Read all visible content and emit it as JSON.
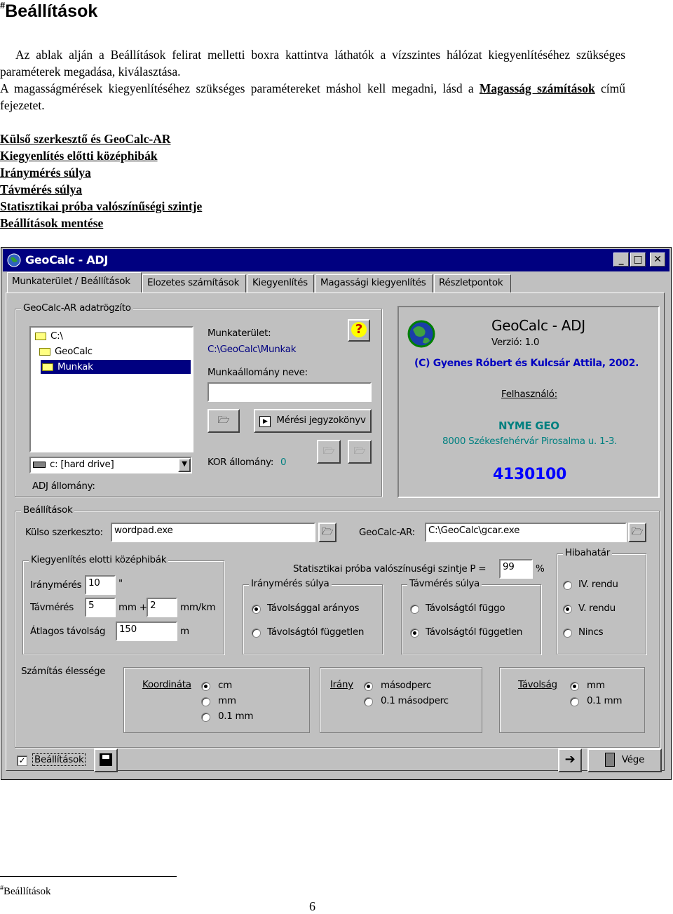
{
  "doc": {
    "title_mark": "#",
    "title": "Beállítások",
    "para1": "Az ablak alján a Beállítások felirat melletti boxra kattintva láthatók a vízszintes hálózat kiegyenlítéséhez szükséges paraméterek megadása, kiválasztása.",
    "para2_prefix": "A magasságmérések kiegyenlítéséhez szükséges paramétereket máshol kell megadni, lásd a ",
    "para2_link": "Magasság számítások",
    "para2_suffix": " című fejezetet.",
    "links": [
      "Külső szerkesztő és GeoCalc-AR",
      "Kiegyenlítés előtti középhibák",
      "Iránymérés súlya",
      "Távmérés súlya",
      "Statisztikai próba valószínűségi szintje",
      "Beállítások mentése"
    ],
    "footnote_mark": "#",
    "footnote": "Beállítások",
    "page_number": "6"
  },
  "window": {
    "title": "GeoCalc - ADJ",
    "controls": [
      "_",
      "□",
      "✕"
    ],
    "tabs": [
      "Munkaterület / Beállítások",
      "Elozetes számítások",
      "Kiegyenlítés",
      "Magassági kiegyenlítés",
      "Részletpontok"
    ],
    "active_tab": 0,
    "adatrogzito": {
      "label": "GeoCalc-AR adatrögzíto",
      "tree": [
        "C:\\",
        "GeoCalc",
        "Munkak"
      ],
      "drive": "c: [hard drive]",
      "munkaterulet_label": "Munkaterület:",
      "munkaterulet_value": "C:\\GeoCalc\\Munkak",
      "munkaallomany_label": "Munkaállomány neve:",
      "munkaallomany_value": "",
      "meresi_button": "Mérési jegyzokönyv",
      "kor_label": "KOR állomány:",
      "kor_value": "0",
      "adj_label": "ADJ állomány:"
    },
    "about": {
      "app_name": "GeoCalc - ADJ",
      "version": "Verzió: 1.0",
      "copyright": "(C) Gyenes Róbert és Kulcsár Attila, 2002.",
      "user_label": "Felhasználó:",
      "org": "NYME GEO",
      "address": "8000 Székesfehérvár Pirosalma u. 1-3.",
      "serial": "4130100"
    },
    "settings": {
      "label": "Beállítások",
      "editor_label": "Külso szerkeszto:",
      "editor_value": "wordpad.exe",
      "geocalc_label": "GeoCalc-AR:",
      "geocalc_value": "C:\\GeoCalc\\gcar.exe",
      "kozephibak": {
        "label": "Kiegyenlítés elotti középhibák",
        "iranymeres_label": "Iránymérés",
        "iranymeres_value": "10",
        "iranymeres_unit": "\"",
        "tavmeres_label": "Távmérés",
        "tavmeres_value": "5",
        "tavmeres_unit1": "mm +",
        "tavmeres_value2": "2",
        "tavmeres_unit2": "mm/km",
        "atlagos_label": "Átlagos távolság",
        "atlagos_value": "150",
        "atlagos_unit": "m"
      },
      "stat_label": "Statisztikai próba valószínuségi szintje  P =",
      "stat_value": "99",
      "stat_unit": "%",
      "irany_suly": {
        "label": "Iránymérés súlya",
        "options": [
          "Távolsággal arányos",
          "Távolságtól független"
        ],
        "selected": 0
      },
      "tav_suly": {
        "label": "Távmérés súlya",
        "options": [
          "Távolságtól függo",
          "Távolságtól független"
        ],
        "selected": 1
      },
      "hibahatar": {
        "label": "Hibahatár",
        "options": [
          "IV. rendu",
          "V. rendu",
          "Nincs"
        ],
        "selected": 1
      },
      "elesseg": {
        "label": "Számítás élessége",
        "koordinata": {
          "label": "Koordináta",
          "options": [
            "cm",
            "mm",
            "0.1 mm"
          ],
          "selected": 0
        },
        "irany": {
          "label": "Irány",
          "options": [
            "másodperc",
            "0.1 másodperc"
          ],
          "selected": 0
        },
        "tavolsag": {
          "label": "Távolság",
          "options": [
            "mm",
            "0.1 mm"
          ],
          "selected": 0
        }
      }
    },
    "bottom": {
      "checkbox_label": "Beállítások",
      "checked": true,
      "vege_button": "Vége"
    }
  }
}
